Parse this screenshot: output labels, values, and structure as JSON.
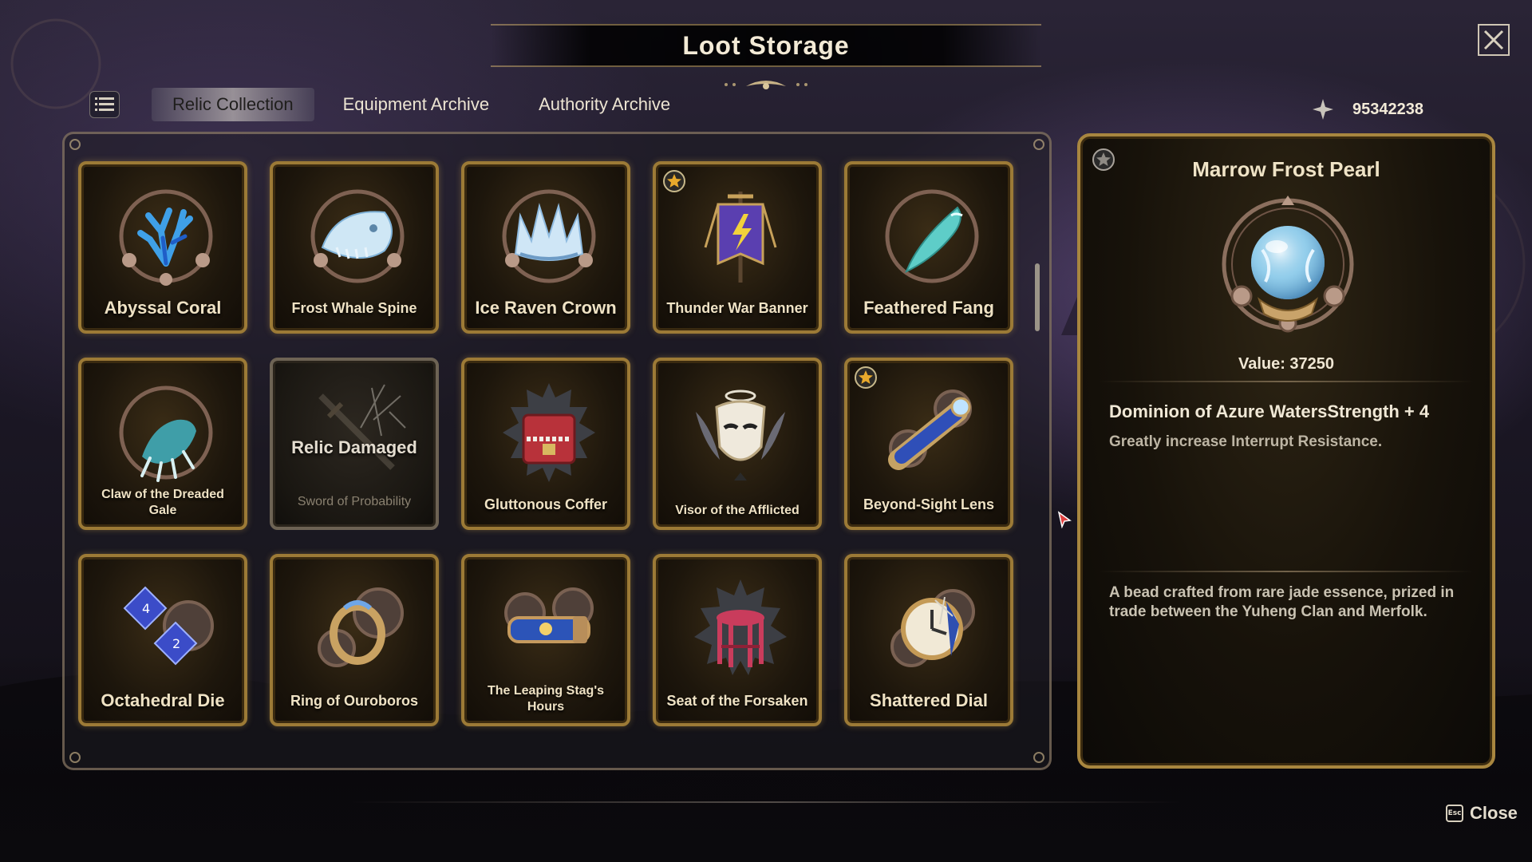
{
  "window": {
    "title": "Loot Storage",
    "close_label": "Close",
    "esc_key": "Esc"
  },
  "tabs": [
    {
      "label": "Relic Collection",
      "active": true
    },
    {
      "label": "Equipment Archive",
      "active": false
    },
    {
      "label": "Authority Archive",
      "active": false
    }
  ],
  "currency": {
    "icon": "sparkle-icon",
    "amount": "95342238"
  },
  "relics": [
    {
      "name": "Abyssal Coral",
      "icon": "coral-icon",
      "starred": false,
      "damaged": false
    },
    {
      "name": "Frost Whale Spine",
      "icon": "whale-skull-icon",
      "starred": false,
      "damaged": false
    },
    {
      "name": "Ice Raven Crown",
      "icon": "crown-icon",
      "starred": false,
      "damaged": false
    },
    {
      "name": "Thunder War Banner",
      "icon": "banner-icon",
      "starred": true,
      "damaged": false
    },
    {
      "name": "Feathered Fang",
      "icon": "fang-icon",
      "starred": false,
      "damaged": false
    },
    {
      "name": "Claw of the Dreaded Gale",
      "icon": "claw-icon",
      "starred": false,
      "damaged": false
    },
    {
      "name": "Sword of Probability",
      "icon": "sword-icon",
      "starred": false,
      "damaged": true,
      "damaged_label": "Relic Damaged"
    },
    {
      "name": "Gluttonous Coffer",
      "icon": "chest-icon",
      "starred": false,
      "damaged": false
    },
    {
      "name": "Visor of the Afflicted",
      "icon": "mask-icon",
      "starred": false,
      "damaged": false
    },
    {
      "name": "Beyond-Sight Lens",
      "icon": "spyglass-icon",
      "starred": true,
      "damaged": false
    },
    {
      "name": "Octahedral Die",
      "icon": "dice-icon",
      "starred": false,
      "damaged": false
    },
    {
      "name": "Ring of Ouroboros",
      "icon": "ring-icon",
      "starred": false,
      "damaged": false
    },
    {
      "name": "The Leaping Stag's Hours",
      "icon": "bracelet-icon",
      "starred": false,
      "damaged": false
    },
    {
      "name": "Seat of the Forsaken",
      "icon": "stool-icon",
      "starred": false,
      "damaged": false
    },
    {
      "name": "Shattered Dial",
      "icon": "clock-icon",
      "starred": false,
      "damaged": false
    }
  ],
  "detail": {
    "title": "Marrow Frost Pearl",
    "icon": "pearl-icon",
    "value_label": "Value: 37250",
    "stat": "Dominion of Azure WatersStrength + 4",
    "stat_desc": "Greatly increase Interrupt Resistance.",
    "lore": "A bead crafted from rare jade essence, prized in trade between the Yuheng Clan and Merfolk."
  },
  "colors": {
    "gold_border": "#9c7a36",
    "star_gold": "#e8a92c",
    "panel_bg": "#17120a"
  }
}
